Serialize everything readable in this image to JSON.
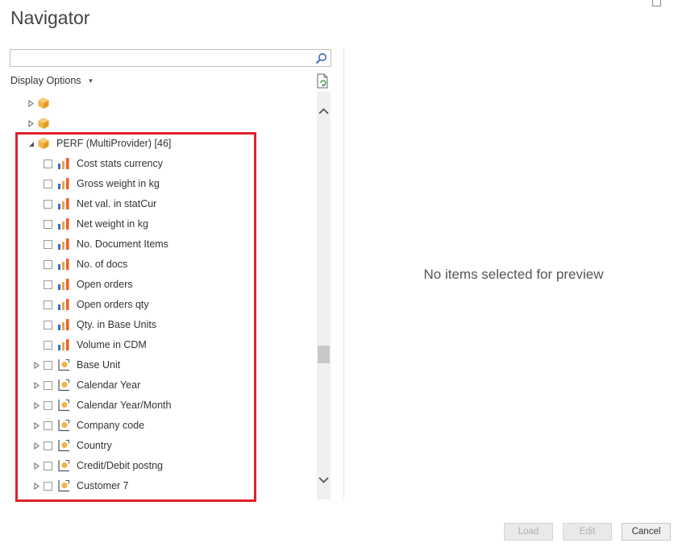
{
  "window": {
    "title": "Navigator"
  },
  "search": {
    "value": "",
    "placeholder": "",
    "icon": "search-icon"
  },
  "display_options": {
    "label": "Display Options",
    "icon": "caret-down-icon"
  },
  "refresh": {
    "icon": "refresh-document-icon"
  },
  "tree": {
    "collapsed_nodes": [
      {
        "label": "",
        "icon": "cube-icon",
        "expanded": false
      },
      {
        "label": "",
        "icon": "cube-icon",
        "expanded": false
      }
    ],
    "provider": {
      "label": "PERF (MultiProvider) [46]",
      "icon": "cube-icon",
      "expanded": true
    },
    "measures": [
      {
        "label": "Cost stats currency",
        "icon": "bar-chart-icon",
        "checked": false
      },
      {
        "label": "Gross weight in kg",
        "icon": "bar-chart-icon",
        "checked": false
      },
      {
        "label": "Net val. in statCur",
        "icon": "bar-chart-icon",
        "checked": false
      },
      {
        "label": "Net weight in kg",
        "icon": "bar-chart-icon",
        "checked": false
      },
      {
        "label": "No. Document Items",
        "icon": "bar-chart-icon",
        "checked": false
      },
      {
        "label": "No. of docs",
        "icon": "bar-chart-icon",
        "checked": false
      },
      {
        "label": "Open orders",
        "icon": "bar-chart-icon",
        "checked": false
      },
      {
        "label": "Open orders qty",
        "icon": "bar-chart-icon",
        "checked": false
      },
      {
        "label": "Qty. in Base Units",
        "icon": "bar-chart-icon",
        "checked": false
      },
      {
        "label": "Volume in CDM",
        "icon": "bar-chart-icon",
        "checked": false
      }
    ],
    "dimensions": [
      {
        "label": "Base Unit",
        "icon": "dimension-icon",
        "checked": false
      },
      {
        "label": "Calendar Year",
        "icon": "dimension-icon",
        "checked": false
      },
      {
        "label": "Calendar Year/Month",
        "icon": "dimension-icon",
        "checked": false
      },
      {
        "label": "Company code",
        "icon": "dimension-icon",
        "checked": false
      },
      {
        "label": "Country",
        "icon": "dimension-icon",
        "checked": false
      },
      {
        "label": "Credit/Debit postng",
        "icon": "dimension-icon",
        "checked": false
      },
      {
        "label": "Customer 7",
        "icon": "dimension-icon",
        "checked": false
      }
    ]
  },
  "preview": {
    "empty_message": "No items selected for preview"
  },
  "buttons": {
    "load": {
      "label": "Load",
      "enabled": false
    },
    "edit": {
      "label": "Edit",
      "enabled": false
    },
    "cancel": {
      "label": "Cancel",
      "enabled": true
    }
  },
  "colors": {
    "highlight": "#e0202a",
    "cube": "#f0a030",
    "bar_orange": "#e8622a",
    "bar_blue": "#3a6fbf"
  }
}
